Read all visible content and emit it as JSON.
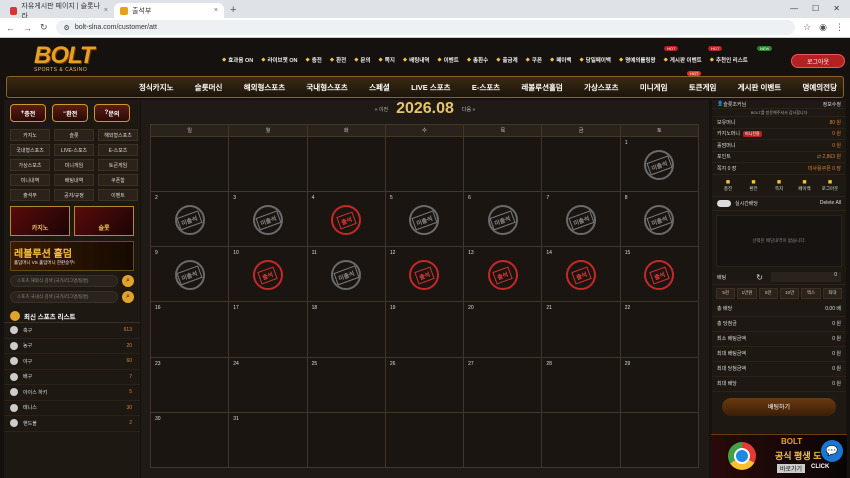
{
  "browser": {
    "tabs": [
      {
        "title": "자유게시판 페이지 | 슬롯나라",
        "active": false
      },
      {
        "title": "출석부",
        "active": true
      }
    ],
    "new_tab": "+",
    "url": "bolt-slna.com/customer/att"
  },
  "header": {
    "logo": "BOLT",
    "logo_sub": "SPORTS & CASINO",
    "top_menu": [
      "효과음 ON",
      "라이브챗 ON",
      "충전",
      "환전",
      "문의",
      "쪽지",
      "배팅내역",
      "이벤트",
      "총환수",
      "출금계",
      "쿠폰",
      "페이백",
      "당일페이백",
      "명예의롤링왕",
      "게시판 이벤트",
      "추천인 리스트"
    ],
    "badges": {
      "hot1": "HOT",
      "hot2": "HOT",
      "new": "NEW"
    },
    "logout": "로그아웃",
    "main_nav": [
      "정식카지노",
      "슬롯머신",
      "해외형스포츠",
      "국내형스포츠",
      "스페셜",
      "LIVE 스포츠",
      "E-스포츠",
      "레볼루션홀덤",
      "가상스포츠",
      "미니게임",
      "토큰게임",
      "게시판 이벤트",
      "명예의전당"
    ],
    "main_nav_badge": "HOT"
  },
  "left": {
    "quick": [
      "충전",
      "환전",
      "문의"
    ],
    "categories": [
      "카지노",
      "슬롯",
      "해외형스포츠",
      "국내형스포츠",
      "LIVE-스포츠",
      "E-스포츠",
      "가상스포츠",
      "미니게임",
      "토큰게임",
      "미니내역",
      "배팅내역",
      "쿠폰함",
      "출석부",
      "공지/규정",
      "이벤트"
    ],
    "banners": [
      "카지노",
      "슬롯"
    ],
    "holdem_title": "레볼루션 홀덤",
    "holdem_sub": "홀덤머니 VS 홀덤머니 한판승부!",
    "search_placeholders": [
      "스포츠 해외식 검색 (국가/리그명/팀명)",
      "스포츠 국내식 검색 (국가/리그명/팀명)"
    ],
    "sports_title": "최신 스포츠 리스트",
    "sports": [
      {
        "name": "축구",
        "count": "613"
      },
      {
        "name": "농구",
        "count": "20"
      },
      {
        "name": "야구",
        "count": "60"
      },
      {
        "name": "배구",
        "count": "7"
      },
      {
        "name": "아이스 하키",
        "count": "5"
      },
      {
        "name": "테니스",
        "count": "30"
      },
      {
        "name": "핸드볼",
        "count": "2"
      }
    ]
  },
  "calendar": {
    "prev": "« 이전",
    "month": "2026.08",
    "next": "다음 »",
    "weekdays": [
      "일",
      "월",
      "화",
      "수",
      "목",
      "금",
      "토"
    ],
    "absent_label": "미출석",
    "present_label": "출석",
    "weeks": [
      [
        {
          "d": ""
        },
        {
          "d": ""
        },
        {
          "d": ""
        },
        {
          "d": ""
        },
        {
          "d": ""
        },
        {
          "d": ""
        },
        {
          "d": "1",
          "s": "gray"
        }
      ],
      [
        {
          "d": "2",
          "s": "gray"
        },
        {
          "d": "3",
          "s": "gray"
        },
        {
          "d": "4",
          "s": "red"
        },
        {
          "d": "5",
          "s": "gray"
        },
        {
          "d": "6",
          "s": "gray"
        },
        {
          "d": "7",
          "s": "gray"
        },
        {
          "d": "8",
          "s": "gray"
        }
      ],
      [
        {
          "d": "9",
          "s": "gray"
        },
        {
          "d": "10",
          "s": "red"
        },
        {
          "d": "11",
          "s": "gray"
        },
        {
          "d": "12",
          "s": "red"
        },
        {
          "d": "13",
          "s": "red"
        },
        {
          "d": "14",
          "s": "red"
        },
        {
          "d": "15",
          "s": "red"
        }
      ],
      [
        {
          "d": "16"
        },
        {
          "d": "17"
        },
        {
          "d": "18"
        },
        {
          "d": "19"
        },
        {
          "d": "20"
        },
        {
          "d": "21"
        },
        {
          "d": "22"
        }
      ],
      [
        {
          "d": "23"
        },
        {
          "d": "24"
        },
        {
          "d": "25"
        },
        {
          "d": "26"
        },
        {
          "d": "27"
        },
        {
          "d": "28"
        },
        {
          "d": "29"
        }
      ],
      [
        {
          "d": "30"
        },
        {
          "d": "31"
        },
        {
          "d": ""
        },
        {
          "d": ""
        },
        {
          "d": ""
        },
        {
          "d": ""
        },
        {
          "d": ""
        }
      ]
    ]
  },
  "right": {
    "user": "슬롯조커님",
    "info_btn": "정보수정",
    "notice": "BOLT를 방문해주셔서 감사합니다",
    "rows": [
      {
        "label": "보유머니",
        "value": "80 원"
      },
      {
        "label": "카지노머니",
        "sub": "머니전환",
        "value": "0 원"
      },
      {
        "label": "홀덤머니",
        "value": "0 원"
      },
      {
        "label": "포인트",
        "value": "⇄ 2,863 원"
      },
      {
        "label": "쪽지 0 장",
        "value": "미사용쿠폰 0 장"
      }
    ],
    "icons": [
      "충전",
      "환전",
      "쪽지",
      "페이백",
      "로그아웃"
    ],
    "slip_toggle": "실시간배당",
    "delete_all": "Delete All",
    "slip_empty": "선택된 배당내역이 없습니다.",
    "bet_label": "배팅",
    "bet_value": "0",
    "chips": [
      "5천",
      "1만원",
      "5만",
      "10만",
      "맥스",
      "최대"
    ],
    "summary": [
      {
        "label": "총 배당",
        "value": "0.00 배"
      },
      {
        "label": "총 당첨금",
        "value": "0 원"
      },
      {
        "label": "최소 배팅금액",
        "value": "0 원"
      },
      {
        "label": "최대 배팅금액",
        "value": "0 원"
      },
      {
        "label": "최대 당첨금액",
        "value": "0 원"
      },
      {
        "label": "최대 배당",
        "value": "0 원"
      }
    ],
    "bet_button": "배팅하기",
    "promo": {
      "t1": "BOLT",
      "t2": "공식 평생 도",
      "t3": "바로가기",
      "click": "CLICK"
    }
  }
}
